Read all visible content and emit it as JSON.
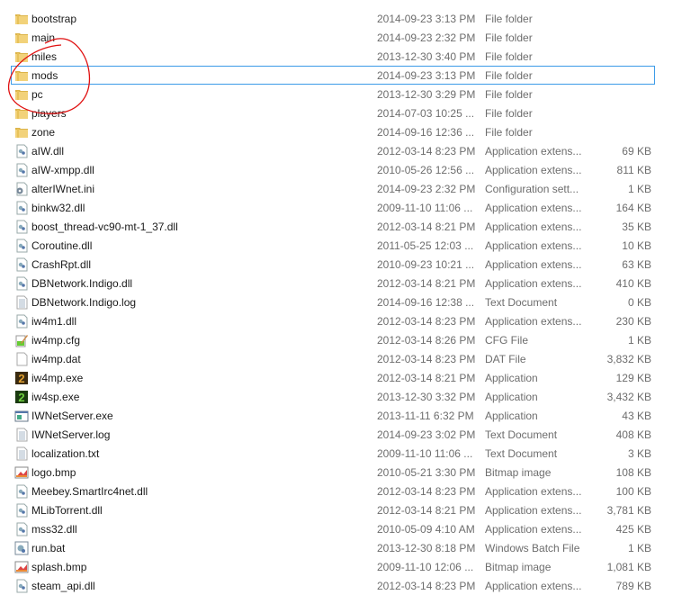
{
  "colors": {
    "selection_border": "#3c9be8",
    "annotation": "#e01010",
    "folder": "#e8c25a"
  },
  "selected_index": 3,
  "files": [
    {
      "name": "bootstrap",
      "date": "2014-09-23 3:13 PM",
      "type": "File folder",
      "size": "",
      "icon": "folder-icon"
    },
    {
      "name": "main",
      "date": "2014-09-23 2:32 PM",
      "type": "File folder",
      "size": "",
      "icon": "folder-icon"
    },
    {
      "name": "miles",
      "date": "2013-12-30 3:40 PM",
      "type": "File folder",
      "size": "",
      "icon": "folder-icon"
    },
    {
      "name": "mods",
      "date": "2014-09-23 3:13 PM",
      "type": "File folder",
      "size": "",
      "icon": "folder-icon"
    },
    {
      "name": "pc",
      "date": "2013-12-30 3:29 PM",
      "type": "File folder",
      "size": "",
      "icon": "folder-icon"
    },
    {
      "name": "players",
      "date": "2014-07-03 10:25 ...",
      "type": "File folder",
      "size": "",
      "icon": "folder-icon"
    },
    {
      "name": "zone",
      "date": "2014-09-16 12:36 ...",
      "type": "File folder",
      "size": "",
      "icon": "folder-icon"
    },
    {
      "name": "aIW.dll",
      "date": "2012-03-14 8:23 PM",
      "type": "Application extens...",
      "size": "69 KB",
      "icon": "dll-icon"
    },
    {
      "name": "aIW-xmpp.dll",
      "date": "2010-05-26 12:56 ...",
      "type": "Application extens...",
      "size": "811 KB",
      "icon": "dll-icon"
    },
    {
      "name": "alterIWnet.ini",
      "date": "2014-09-23 2:32 PM",
      "type": "Configuration sett...",
      "size": "1 KB",
      "icon": "config-icon"
    },
    {
      "name": "binkw32.dll",
      "date": "2009-11-10 11:06 ...",
      "type": "Application extens...",
      "size": "164 KB",
      "icon": "dll-icon"
    },
    {
      "name": "boost_thread-vc90-mt-1_37.dll",
      "date": "2012-03-14 8:21 PM",
      "type": "Application extens...",
      "size": "35 KB",
      "icon": "dll-icon"
    },
    {
      "name": "Coroutine.dll",
      "date": "2011-05-25 12:03 ...",
      "type": "Application extens...",
      "size": "10 KB",
      "icon": "dll-icon"
    },
    {
      "name": "CrashRpt.dll",
      "date": "2010-09-23 10:21 ...",
      "type": "Application extens...",
      "size": "63 KB",
      "icon": "dll-icon"
    },
    {
      "name": "DBNetwork.Indigo.dll",
      "date": "2012-03-14 8:21 PM",
      "type": "Application extens...",
      "size": "410 KB",
      "icon": "dll-icon"
    },
    {
      "name": "DBNetwork.Indigo.log",
      "date": "2014-09-16 12:38 ...",
      "type": "Text Document",
      "size": "0 KB",
      "icon": "text-file-icon"
    },
    {
      "name": "iw4m1.dll",
      "date": "2012-03-14 8:23 PM",
      "type": "Application extens...",
      "size": "230 KB",
      "icon": "dll-icon"
    },
    {
      "name": "iw4mp.cfg",
      "date": "2012-03-14 8:26 PM",
      "type": "CFG File",
      "size": "1 KB",
      "icon": "cfg-edit-icon"
    },
    {
      "name": "iw4mp.dat",
      "date": "2012-03-14 8:23 PM",
      "type": "DAT File",
      "size": "3,832 KB",
      "icon": "blank-file-icon"
    },
    {
      "name": "iw4mp.exe",
      "date": "2012-03-14 8:21 PM",
      "type": "Application",
      "size": "129 KB",
      "icon": "mw2-mp-icon"
    },
    {
      "name": "iw4sp.exe",
      "date": "2013-12-30 3:32 PM",
      "type": "Application",
      "size": "3,432 KB",
      "icon": "mw2-sp-icon"
    },
    {
      "name": "IWNetServer.exe",
      "date": "2013-11-11 6:32 PM",
      "type": "Application",
      "size": "43 KB",
      "icon": "window-app-icon"
    },
    {
      "name": "IWNetServer.log",
      "date": "2014-09-23 3:02 PM",
      "type": "Text Document",
      "size": "408 KB",
      "icon": "text-file-icon"
    },
    {
      "name": "localization.txt",
      "date": "2009-11-10 11:06 ...",
      "type": "Text Document",
      "size": "3 KB",
      "icon": "text-file-icon"
    },
    {
      "name": "logo.bmp",
      "date": "2010-05-21 3:30 PM",
      "type": "Bitmap image",
      "size": "108 KB",
      "icon": "bitmap-icon"
    },
    {
      "name": "Meebey.SmartIrc4net.dll",
      "date": "2012-03-14 8:23 PM",
      "type": "Application extens...",
      "size": "100 KB",
      "icon": "dll-icon"
    },
    {
      "name": "MLibTorrent.dll",
      "date": "2012-03-14 8:21 PM",
      "type": "Application extens...",
      "size": "3,781 KB",
      "icon": "dll-icon"
    },
    {
      "name": "mss32.dll",
      "date": "2010-05-09 4:10 AM",
      "type": "Application extens...",
      "size": "425 KB",
      "icon": "dll-icon"
    },
    {
      "name": "run.bat",
      "date": "2013-12-30 8:18 PM",
      "type": "Windows Batch File",
      "size": "1 KB",
      "icon": "batch-file-icon"
    },
    {
      "name": "splash.bmp",
      "date": "2009-11-10 12:06 ...",
      "type": "Bitmap image",
      "size": "1,081 KB",
      "icon": "bitmap-icon"
    },
    {
      "name": "steam_api.dll",
      "date": "2012-03-14 8:23 PM",
      "type": "Application extens...",
      "size": "789 KB",
      "icon": "dll-icon"
    }
  ]
}
